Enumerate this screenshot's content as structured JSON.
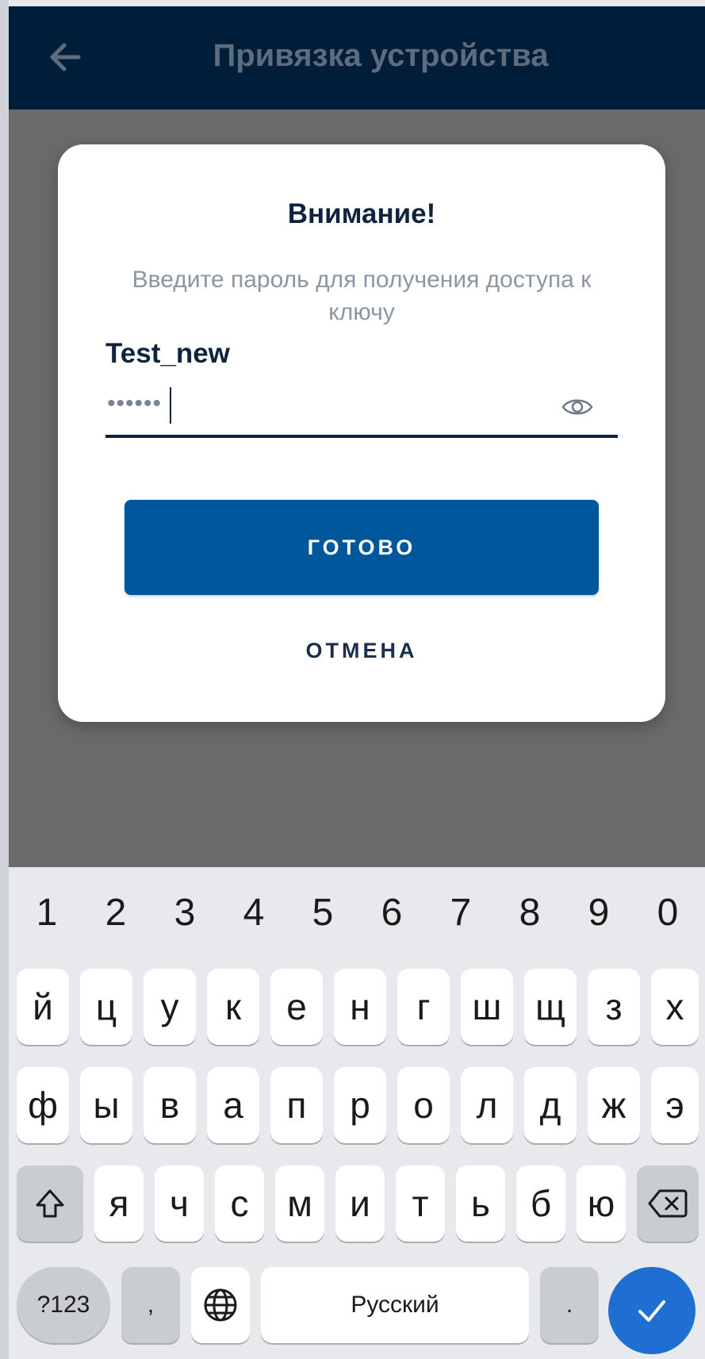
{
  "appbar": {
    "back_icon": "arrow-left-icon",
    "title": "Привязка устройства"
  },
  "dialog": {
    "title": "Внимание!",
    "message": "Введите пароль для получения доступа к ключу",
    "key_name": "Test_new",
    "password_value": "••••••",
    "password_toggle_icon": "eye-icon",
    "ok_label": "ГОТОВО",
    "cancel_label": "ОТМЕНА"
  },
  "keyboard": {
    "numbers": [
      "1",
      "2",
      "3",
      "4",
      "5",
      "6",
      "7",
      "8",
      "9",
      "0"
    ],
    "row1": [
      "й",
      "ц",
      "у",
      "к",
      "е",
      "н",
      "г",
      "ш",
      "щ",
      "з",
      "х"
    ],
    "row2": [
      "ф",
      "ы",
      "в",
      "а",
      "п",
      "р",
      "о",
      "л",
      "д",
      "ж",
      "э"
    ],
    "row3": [
      "я",
      "ч",
      "с",
      "м",
      "и",
      "т",
      "ь",
      "б",
      "ю"
    ],
    "shift_icon": "shift-icon",
    "backspace_icon": "backspace-icon",
    "symbols_label": "?123",
    "comma_label": ",",
    "language_icon": "globe-icon",
    "space_label": "Русский",
    "period_label": ".",
    "enter_icon": "check-icon"
  },
  "colors": {
    "appbar_bg": "#001e3a",
    "primary_button": "#00579c",
    "scrim": "#6a6a6a",
    "enter_key": "#1f6fd2"
  }
}
